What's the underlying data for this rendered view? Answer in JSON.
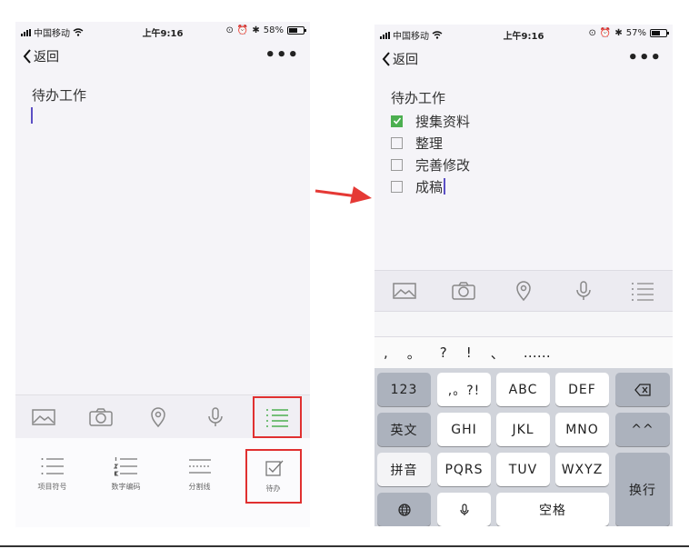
{
  "left": {
    "status": {
      "carrier": "中国移动",
      "time": "上午9:16",
      "battery": "58%",
      "battery_level": 0.58
    },
    "nav": {
      "back_label": "返回",
      "more_label": "•••"
    },
    "note_title": "待办工作",
    "toolbar_icons": [
      "image-icon",
      "camera-icon",
      "location-icon",
      "mic-icon",
      "list-icon"
    ],
    "subpanel": [
      {
        "label": "项目符号",
        "icon": "bullet-list-icon"
      },
      {
        "label": "数字编码",
        "icon": "numbered-list-icon"
      },
      {
        "label": "分割线",
        "icon": "divider-line-icon"
      },
      {
        "label": "待办",
        "icon": "todo-check-icon"
      }
    ]
  },
  "right": {
    "status": {
      "carrier": "中国移动",
      "time": "上午9:16",
      "battery": "57%",
      "battery_level": 0.57
    },
    "nav": {
      "back_label": "返回",
      "more_label": "•••"
    },
    "note_title": "待办工作",
    "todos": [
      {
        "text": "搜集资料",
        "checked": true
      },
      {
        "text": "整理",
        "checked": false
      },
      {
        "text": "完善修改",
        "checked": false
      },
      {
        "text": "成稿",
        "checked": false
      }
    ],
    "toolbar_icons": [
      "image-icon",
      "camera-icon",
      "location-icon",
      "mic-icon",
      "list-icon"
    ],
    "candidates": [
      ",",
      "。",
      "?",
      "!",
      "、",
      "……"
    ],
    "keyboard": {
      "row1": [
        "123",
        ",。?!",
        "ABC",
        "DEF",
        "delete-icon"
      ],
      "row2": [
        "英文",
        "GHI",
        "JKL",
        "MNO",
        "^^"
      ],
      "row3": [
        "拼音",
        "PQRS",
        "TUV",
        "WXYZ",
        "换行"
      ],
      "row4": [
        "globe-icon",
        "mic-icon",
        "空格"
      ]
    }
  },
  "colors": {
    "highlight": "#e03030",
    "checkbox_on": "#4caf50",
    "cursor": "#5b4fc4"
  }
}
